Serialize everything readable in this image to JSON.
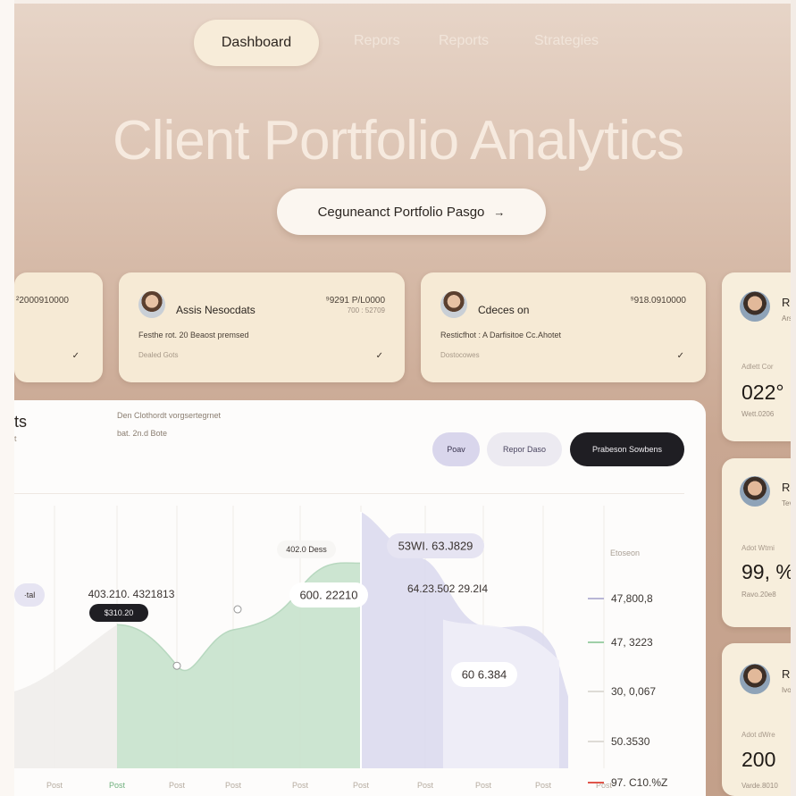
{
  "nav": {
    "active": "Dashboard",
    "links": [
      "Repors",
      "Reports",
      "Strategies"
    ]
  },
  "hero": {
    "title": "Client Portfolio Analytics",
    "cta": "Ceguneanct Portfolio Pasgo",
    "cta_icon": "arrow-right-icon"
  },
  "client_cards": [
    {
      "amount": "²2000910000"
    },
    {
      "name": "Assis Nesocdats",
      "amount": "⁹9291 P/L0000",
      "subamount": "700 : 52709",
      "desc": "Festhe rot. 20 Beaost premsed",
      "meta": "Dealed Gots"
    },
    {
      "name": "Cdeces on",
      "amount": "⁹918.0910000",
      "desc": "Resticfhot : A Darfisitoe Cc.Ahotet",
      "meta": "Dostocowes"
    }
  ],
  "stat_cards": [
    {
      "name": "Ri",
      "sub": "Ars",
      "label": "Adlett Cor",
      "value": "022°",
      "foot": "Wett.0206"
    },
    {
      "name": "Re",
      "sub": "Tev",
      "label": "Adot Wtmi",
      "value": "99, %",
      "foot": "Ravo.20e8"
    },
    {
      "name": "Ri",
      "sub": "Ivo",
      "label": "Adot dWre",
      "value": "200",
      "foot": "Varde.8010"
    }
  ],
  "panel": {
    "title": "ts",
    "subtitle": "t",
    "caption1": "Den Clothordt vorgsertegrnet",
    "caption2": "bat. 2n.d Bote",
    "seg1": "Poav",
    "seg2": "Repor Daso",
    "seg3": "Prabeson Sowbens"
  },
  "chart_data": {
    "type": "area",
    "x": [
      "Post",
      "Post",
      "Post",
      "Post",
      "Post",
      "Post",
      "Post",
      "Post",
      "Post",
      "Post",
      "Post"
    ],
    "legend_title": "Etoseon",
    "legend": [
      {
        "label": "47,800,8",
        "color": "#b9b6d6"
      },
      {
        "label": "47, 3223",
        "color": "#9fd0a8"
      },
      {
        "label": "30, 0,067",
        "color": "#dedbd6"
      },
      {
        "label": "50.3530",
        "color": "#dedbd6"
      },
      {
        "label": "97. C10.%Z",
        "color": "#e0554a"
      }
    ],
    "annotations": [
      {
        "text": "403.210. 4321813"
      },
      {
        "text": "$310.20"
      },
      {
        "text": "402.0 Dess"
      },
      {
        "text": "53WI. 63.J829"
      },
      {
        "text": "600. 22210"
      },
      {
        "text": "64.23.502 29.2I4"
      },
      {
        "text": "60 6.384"
      },
      {
        "text": "·tal"
      }
    ],
    "series": [
      {
        "values": [
          35,
          58,
          53,
          40,
          52,
          44,
          68,
          100,
          83,
          58,
          43
        ]
      },
      {
        "values": [
          18,
          16,
          14,
          12,
          15,
          14,
          14,
          16,
          88,
          40,
          30
        ]
      }
    ]
  }
}
